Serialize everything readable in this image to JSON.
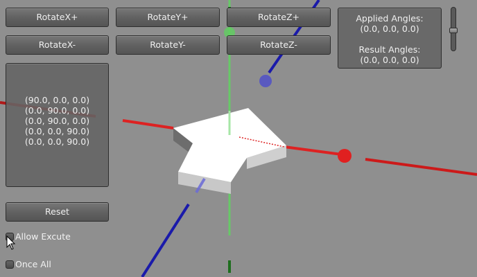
{
  "buttons": {
    "rotate_x_plus": "RotateX+",
    "rotate_y_plus": "RotateY+",
    "rotate_z_plus": "RotateZ+",
    "rotate_x_minus": "RotateX-",
    "rotate_y_minus": "RotateY-",
    "rotate_z_minus": "RotateZ-",
    "reset": "Reset"
  },
  "angles_list": [
    "(90.0, 0.0, 0.0)",
    "(0.0, 90.0, 0.0)",
    "(0.0, 90.0, 0.0)",
    "(0.0, 0.0, 90.0)",
    "(0.0, 0.0, 90.0)"
  ],
  "info": {
    "applied_label": "Applied Angles:",
    "applied_value": "(0.0, 0.0, 0.0)",
    "result_label": "Result Angles:",
    "result_value": "(0.0, 0.0, 0.0)"
  },
  "toggles": {
    "allow_execute": "Allow Excute",
    "once_all": "Once All"
  },
  "colors": {
    "x_axis": "#dd2222",
    "y_axis": "#44bb44",
    "z_axis": "#1a1aaa",
    "viewport_background": "#8f8f8f"
  }
}
